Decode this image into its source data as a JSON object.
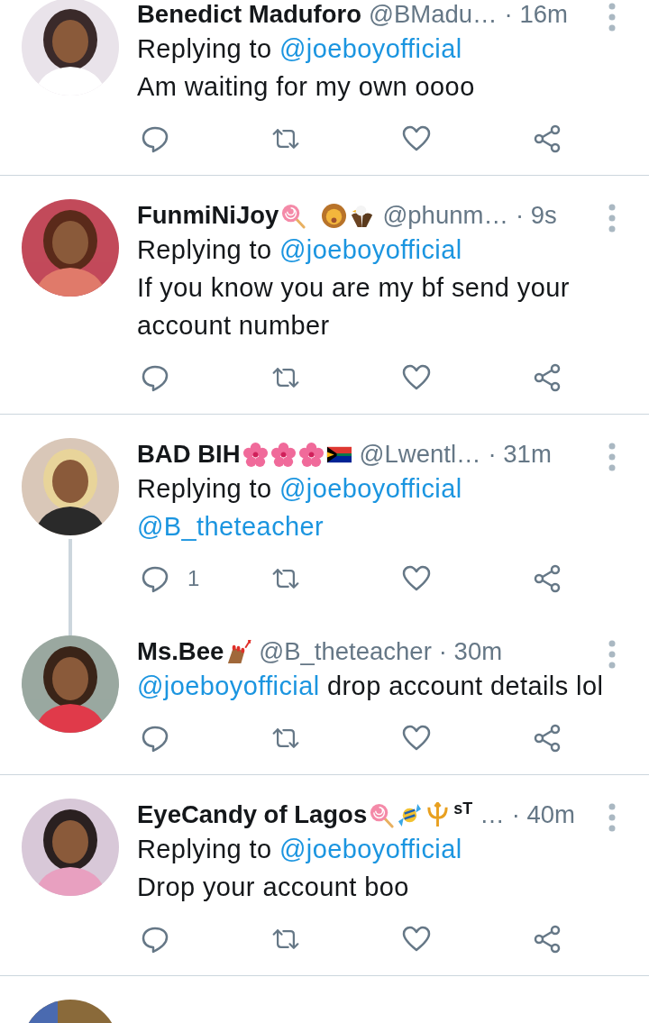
{
  "tweets": [
    {
      "name": "Benedict Maduforo",
      "handle": "@BMadu…",
      "time": "· 16m",
      "replying_label": "Replying to",
      "replying_to": "@joeboyofficial",
      "text_parts": [
        {
          "kind": "plain",
          "text": "Am waiting for my own oooo"
        }
      ],
      "thread_start": false
    },
    {
      "name": "FunmiNiJoy",
      "emojis": [
        {
          "kind": "lollipop"
        },
        {
          "kind": "space"
        },
        {
          "kind": "lion"
        },
        {
          "kind": "eagle"
        }
      ],
      "handle": "@phunm…",
      "time": "· 9s",
      "replying_label": "Replying to",
      "replying_to": "@joeboyofficial",
      "text_parts": [
        {
          "kind": "plain",
          "text": "If you know you are my bf send your account number"
        }
      ],
      "thread_start": false
    },
    {
      "name": "BAD BIH",
      "emojis": [
        {
          "kind": "hibiscus"
        },
        {
          "kind": "hibiscus"
        },
        {
          "kind": "hibiscus"
        },
        {
          "kind": "flag"
        }
      ],
      "handle": "@Lwentl…",
      "time": "· 31m",
      "replying_label": "Replying to",
      "replying_to": "@joeboyofficial",
      "text_parts": [
        {
          "kind": "mention",
          "text": "@B_theteacher"
        }
      ],
      "reply_count": "1",
      "thread_start": true
    },
    {
      "name": "Ms.Bee",
      "emojis": [
        {
          "kind": "nails"
        }
      ],
      "handle": "@B_theteacher",
      "time": "· 30m",
      "text_parts": [
        {
          "kind": "mention",
          "text": "@joeboyofficial"
        },
        {
          "kind": "plain",
          "text": " drop account details lol"
        }
      ],
      "thread_start": false
    },
    {
      "name": "EyeCandy of Lagos",
      "emojis": [
        {
          "kind": "lollipop"
        },
        {
          "kind": "candy"
        },
        {
          "kind": "trident"
        }
      ],
      "name_suffix": "sT",
      "handle": "…",
      "time": "· 40m",
      "replying_label": "Replying to",
      "replying_to": "@joeboyofficial",
      "text_parts": [
        {
          "kind": "plain",
          "text": "Drop your account boo"
        }
      ],
      "thread_start": false
    }
  ]
}
